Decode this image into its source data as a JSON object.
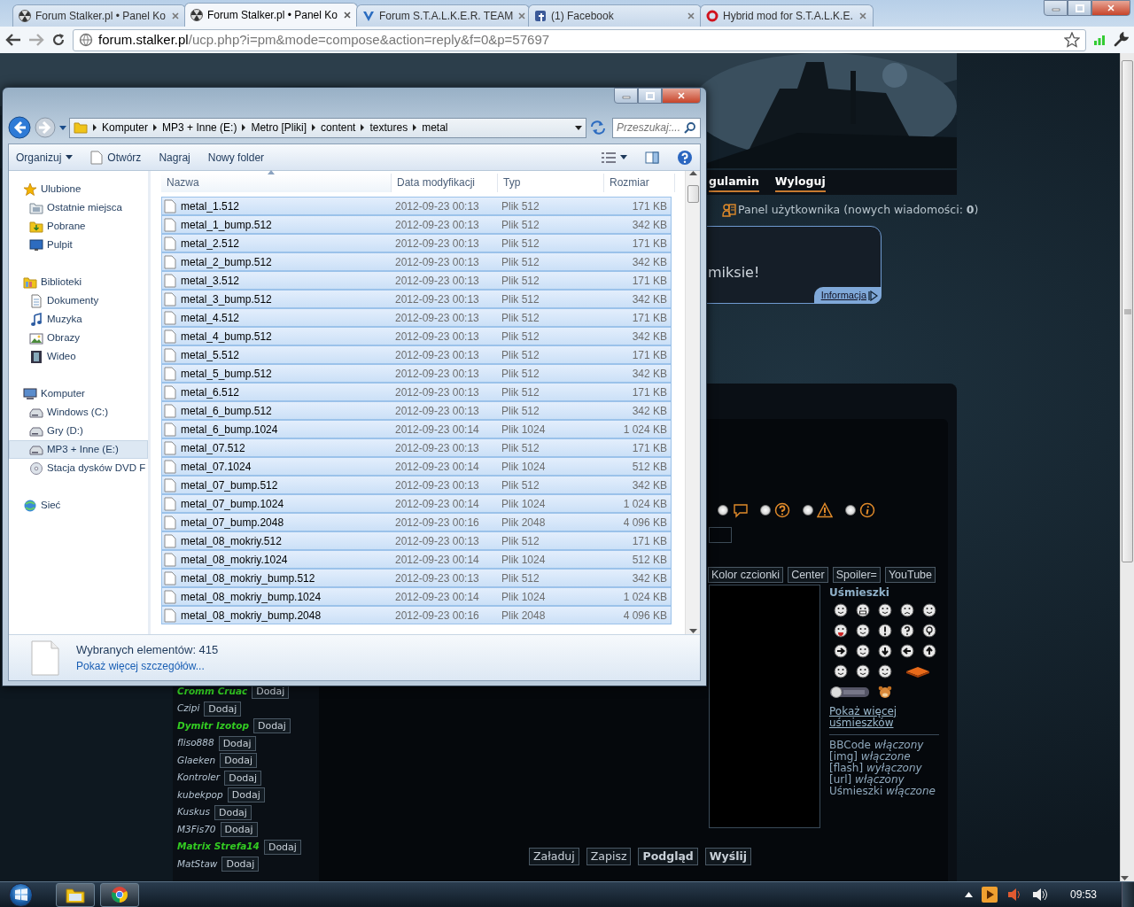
{
  "browser": {
    "tabs": [
      {
        "title": "Forum Stalker.pl • Panel Ko",
        "kind": "trefoil",
        "selected": false
      },
      {
        "title": "Forum Stalker.pl • Panel Ko",
        "kind": "trefoil",
        "selected": true
      },
      {
        "title": "Forum S.T.A.L.K.E.R. TEAM",
        "kind": "chevron",
        "selected": false
      },
      {
        "title": "(1) Facebook",
        "kind": "tile",
        "selected": false
      },
      {
        "title": "Hybrid mod for S.T.A.L.K.E.",
        "kind": "ring",
        "selected": false
      }
    ],
    "url": {
      "host": "forum.stalker.pl",
      "path": "/ucp.php?i=pm&mode=compose&action=reply&f=0&p=57697"
    }
  },
  "forum": {
    "nav": [
      "gulamin",
      "Wyloguj"
    ],
    "user_panel": "Panel użytkownika (nowych wiadomości: **0**)",
    "notice": {
      "text": "miksie!",
      "tab": "Informacja"
    },
    "icon_options": [
      {
        "selected": false
      },
      {
        "selected": false
      },
      {
        "selected": false
      },
      {
        "selected": false
      }
    ],
    "format_buttons": [
      "Kolor czcionki",
      "Center",
      "Spoiler=",
      "YouTube"
    ],
    "smilies": {
      "title": "Uśmieszki",
      "more": "Pokaż więcej uśmieszków",
      "status": [
        "BBCode *włączony*",
        "[img] *włączone*",
        "[flash] *wyłączony*",
        "[url] *włączony*",
        "Uśmieszki *włączone*"
      ]
    },
    "friends": [
      {
        "name": "Cromm Cruac",
        "color": "#33cc22",
        "bold": true,
        "button": "Dodaj"
      },
      {
        "name": "Czipi",
        "color": "#b4c4d2",
        "bold": false,
        "button": "Dodaj"
      },
      {
        "name": "Dymitr Izotop",
        "color": "#33cc22",
        "bold": true,
        "button": "Dodaj"
      },
      {
        "name": "fliso888",
        "color": "#b4c4d2",
        "bold": false,
        "button": "Dodaj"
      },
      {
        "name": "Glaeken",
        "color": "#b4c4d2",
        "bold": false,
        "button": "Dodaj"
      },
      {
        "name": "Kontroler",
        "color": "#b4c4d2",
        "bold": false,
        "button": "Dodaj"
      },
      {
        "name": "kubekpop",
        "color": "#b4c4d2",
        "bold": false,
        "button": "Dodaj"
      },
      {
        "name": "Kuskus",
        "color": "#b4c4d2",
        "bold": false,
        "button": "Dodaj"
      },
      {
        "name": "M3Fis70",
        "color": "#b4c4d2",
        "bold": false,
        "button": "Dodaj"
      },
      {
        "name": "Matrix Strefa14",
        "color": "#33cc22",
        "bold": true,
        "button": "Dodaj"
      },
      {
        "name": "MatStaw",
        "color": "#b4c4d2",
        "bold": false,
        "button": "Dodaj"
      }
    ],
    "actions": [
      {
        "label": "Załaduj",
        "kind": "default"
      },
      {
        "label": "Zapisz",
        "kind": "default"
      },
      {
        "label": "Podgląd",
        "kind": "bold"
      },
      {
        "label": "Wyślij",
        "kind": "bold"
      }
    ]
  },
  "explorer": {
    "breadcrumb": [
      "Komputer",
      "MP3 + Inne (E:)",
      "Metro [Pliki]",
      "content",
      "textures",
      "metal"
    ],
    "search": {
      "placeholder": "Przeszukaj:..."
    },
    "toolbar": [
      {
        "label": "Organizuj",
        "kind": "menu"
      },
      {
        "label": "Otwórz",
        "kind": "open"
      },
      {
        "label": "Nagraj",
        "kind": "plain"
      },
      {
        "label": "Nowy folder",
        "kind": "plain"
      }
    ],
    "nav": [
      {
        "label": "Ulubione",
        "kind": "star",
        "selected": false,
        "children": [
          {
            "label": "Ostatnie miejsca",
            "kind": "recent",
            "selected": false
          },
          {
            "label": "Pobrane",
            "kind": "folder",
            "selected": false
          },
          {
            "label": "Pulpit",
            "kind": "desktop",
            "selected": false
          }
        ]
      },
      {
        "label": "Biblioteki",
        "kind": "library",
        "selected": false,
        "children": [
          {
            "label": "Dokumenty",
            "kind": "doc",
            "selected": false
          },
          {
            "label": "Muzyka",
            "kind": "music",
            "selected": false
          },
          {
            "label": "Obrazy",
            "kind": "pictures",
            "selected": false
          },
          {
            "label": "Wideo",
            "kind": "video",
            "selected": false
          }
        ]
      },
      {
        "label": "Komputer",
        "kind": "computer",
        "selected": false,
        "children": [
          {
            "label": "Windows (C:)",
            "kind": "drive",
            "selected": false
          },
          {
            "label": "Gry (D:)",
            "kind": "drive",
            "selected": false
          },
          {
            "label": "MP3 + Inne (E:)",
            "kind": "drive",
            "selected": true
          },
          {
            "label": "Stacja dysków DVD F",
            "kind": "dvd",
            "selected": false
          }
        ]
      },
      {
        "label": "Sieć",
        "kind": "network",
        "selected": false
      }
    ],
    "columns": [
      {
        "label": "Nazwa",
        "sorted": true
      },
      {
        "label": "Data modyfikacji",
        "sorted": false
      },
      {
        "label": "Typ",
        "sorted": false
      },
      {
        "label": "Rozmiar",
        "sorted": false
      }
    ],
    "files": [
      {
        "name": "metal_1.512",
        "date": "2012-09-23 00:13",
        "type": "Plik 512",
        "size": "171 KB",
        "selected": true
      },
      {
        "name": "metal_1_bump.512",
        "date": "2012-09-23 00:13",
        "type": "Plik 512",
        "size": "342 KB",
        "selected": true
      },
      {
        "name": "metal_2.512",
        "date": "2012-09-23 00:13",
        "type": "Plik 512",
        "size": "171 KB",
        "selected": true
      },
      {
        "name": "metal_2_bump.512",
        "date": "2012-09-23 00:13",
        "type": "Plik 512",
        "size": "342 KB",
        "selected": true
      },
      {
        "name": "metal_3.512",
        "date": "2012-09-23 00:13",
        "type": "Plik 512",
        "size": "171 KB",
        "selected": true
      },
      {
        "name": "metal_3_bump.512",
        "date": "2012-09-23 00:13",
        "type": "Plik 512",
        "size": "342 KB",
        "selected": true
      },
      {
        "name": "metal_4.512",
        "date": "2012-09-23 00:13",
        "type": "Plik 512",
        "size": "171 KB",
        "selected": true
      },
      {
        "name": "metal_4_bump.512",
        "date": "2012-09-23 00:13",
        "type": "Plik 512",
        "size": "342 KB",
        "selected": true
      },
      {
        "name": "metal_5.512",
        "date": "2012-09-23 00:13",
        "type": "Plik 512",
        "size": "171 KB",
        "selected": true
      },
      {
        "name": "metal_5_bump.512",
        "date": "2012-09-23 00:13",
        "type": "Plik 512",
        "size": "342 KB",
        "selected": true
      },
      {
        "name": "metal_6.512",
        "date": "2012-09-23 00:13",
        "type": "Plik 512",
        "size": "171 KB",
        "selected": true
      },
      {
        "name": "metal_6_bump.512",
        "date": "2012-09-23 00:13",
        "type": "Plik 512",
        "size": "342 KB",
        "selected": true
      },
      {
        "name": "metal_6_bump.1024",
        "date": "2012-09-23 00:14",
        "type": "Plik 1024",
        "size": "1 024 KB",
        "selected": true
      },
      {
        "name": "metal_07.512",
        "date": "2012-09-23 00:13",
        "type": "Plik 512",
        "size": "171 KB",
        "selected": true
      },
      {
        "name": "metal_07.1024",
        "date": "2012-09-23 00:14",
        "type": "Plik 1024",
        "size": "512 KB",
        "selected": true
      },
      {
        "name": "metal_07_bump.512",
        "date": "2012-09-23 00:13",
        "type": "Plik 512",
        "size": "342 KB",
        "selected": true
      },
      {
        "name": "metal_07_bump.1024",
        "date": "2012-09-23 00:14",
        "type": "Plik 1024",
        "size": "1 024 KB",
        "selected": true
      },
      {
        "name": "metal_07_bump.2048",
        "date": "2012-09-23 00:16",
        "type": "Plik 2048",
        "size": "4 096 KB",
        "selected": true
      },
      {
        "name": "metal_08_mokriy.512",
        "date": "2012-09-23 00:13",
        "type": "Plik 512",
        "size": "171 KB",
        "selected": true
      },
      {
        "name": "metal_08_mokriy.1024",
        "date": "2012-09-23 00:14",
        "type": "Plik 1024",
        "size": "512 KB",
        "selected": true
      },
      {
        "name": "metal_08_mokriy_bump.512",
        "date": "2012-09-23 00:13",
        "type": "Plik 512",
        "size": "342 KB",
        "selected": true
      },
      {
        "name": "metal_08_mokriy_bump.1024",
        "date": "2012-09-23 00:14",
        "type": "Plik 1024",
        "size": "1 024 KB",
        "selected": true
      },
      {
        "name": "metal_08_mokriy_bump.2048",
        "date": "2012-09-23 00:16",
        "type": "Plik 2048",
        "size": "4 096 KB",
        "selected": true
      }
    ],
    "details": {
      "count": "Wybranych elementów: 415",
      "link": "Pokaż więcej szczegółów..."
    }
  },
  "taskbar": {
    "clock": "09:53"
  }
}
